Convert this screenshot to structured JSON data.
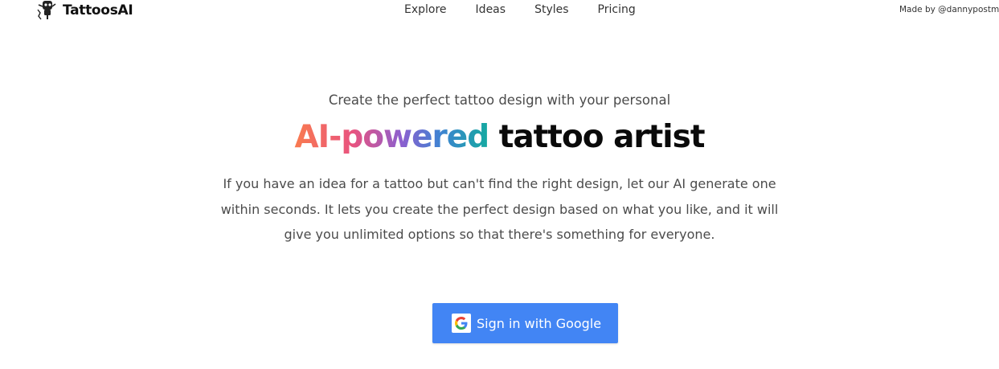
{
  "header": {
    "logo_text": "TattoosAI",
    "nav": [
      {
        "label": "Explore"
      },
      {
        "label": "Ideas"
      },
      {
        "label": "Styles"
      },
      {
        "label": "Pricing"
      }
    ],
    "made_by": "Made by @dannypostmc"
  },
  "hero": {
    "tagline": "Create the perfect tattoo design with your personal",
    "headline_gradient": "AI-powered",
    "headline_plain": "tattoo artist",
    "description": "If you have an idea for a tattoo but can't find the right design, let our AI generate one within seconds. It lets you create the perfect design based on what you like, and it will give you unlimited options so that there's something for everyone.",
    "cta_label": "Sign in with Google"
  },
  "colors": {
    "button_bg": "#4285f4",
    "gradient": [
      "#f97b4f",
      "#e9537f",
      "#8d5fcf",
      "#3f83d2",
      "#14a9a0"
    ],
    "text_muted": "#4b4b4b"
  },
  "icons": {
    "logo": "robot-tattoo-machine-icon",
    "cta": "google-g-icon"
  }
}
